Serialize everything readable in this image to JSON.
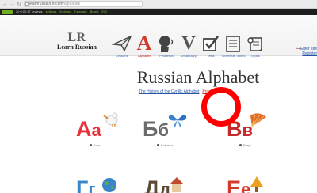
{
  "browser": {
    "url_host": "learnrussian.rt.com",
    "url_path": "/alphabet/",
    "bookmarks": [
      "20 0:00  87 reviews",
      "settings",
      "findings",
      "Translate",
      "Bored",
      "EIG"
    ]
  },
  "header": {
    "logo_mark": "LR",
    "logo_name": "Learn Russian",
    "nav": [
      {
        "label": "Lessons",
        "icon": "paper-plane-icon"
      },
      {
        "label": "Alphabet",
        "icon": "letter-a-icon"
      },
      {
        "label": "Phonetics",
        "icon": "head-sound-icon"
      },
      {
        "label": "Vocabulary",
        "icon": "letter-v-icon"
      },
      {
        "label": "Tests",
        "icon": "checkbox-icon"
      },
      {
        "label": "Grammar Tables",
        "icon": "table-icon"
      },
      {
        "label": "Topics",
        "icon": "scroll-icon"
      }
    ],
    "enter_site": "Enter site",
    "register": "Register"
  },
  "main": {
    "title": "Russian Alphabet",
    "history_link": "The History of the Cyrillic Alphabet",
    "practice_link": "Practice"
  },
  "letters": [
    {
      "upper": "А",
      "lower": "а",
      "caption": "Аист",
      "color": "#e8313a"
    },
    {
      "upper": "Б",
      "lower": "б",
      "caption": "Бабочка",
      "color": "#6a6a6a"
    },
    {
      "upper": "В",
      "lower": "в",
      "caption": "Веер",
      "color": "#c52a2a"
    },
    {
      "upper": "Г",
      "lower": "г",
      "color": "#3a86c8"
    },
    {
      "upper": "Д",
      "lower": "д",
      "color": "#5e4a34"
    },
    {
      "upper": "Е",
      "lower": "е",
      "color": "#d23a2c"
    }
  ]
}
